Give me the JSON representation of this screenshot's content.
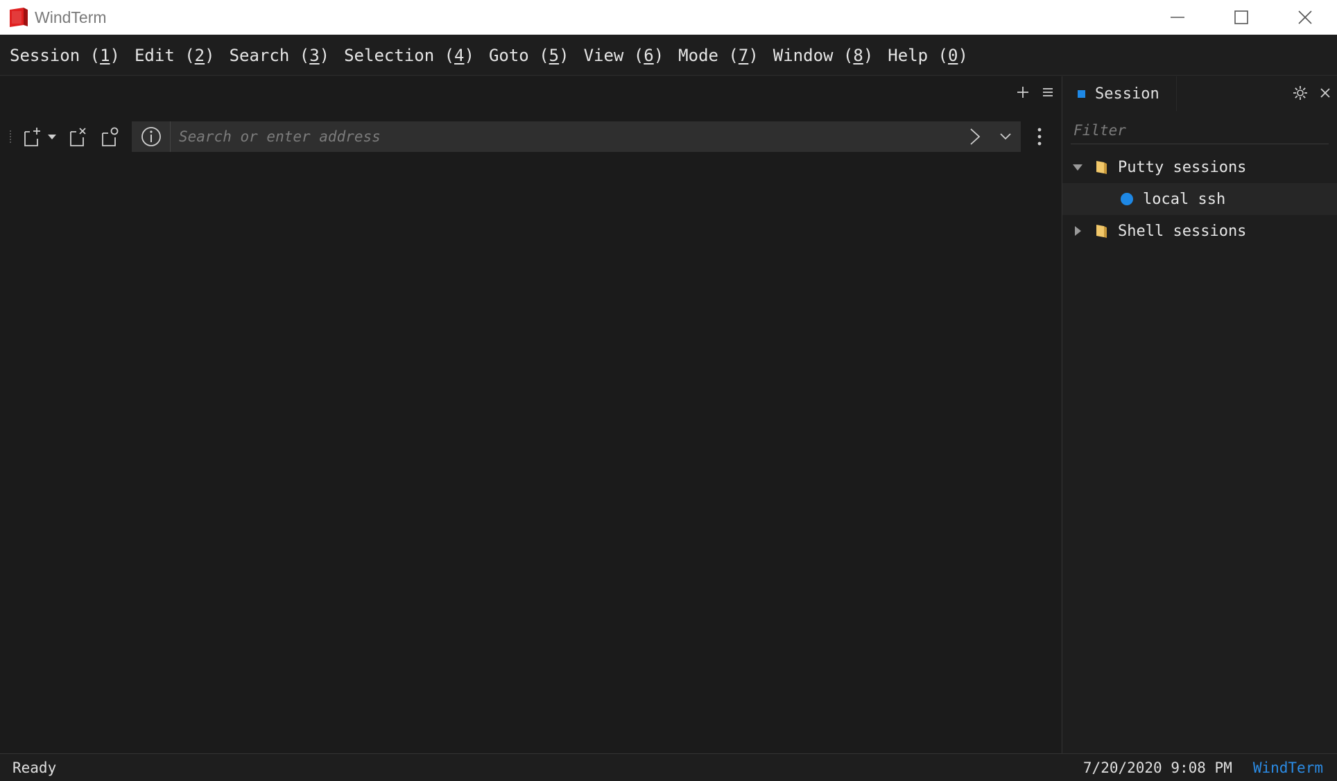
{
  "window": {
    "title": "WindTerm",
    "controls": [
      "minimize",
      "maximize",
      "close"
    ]
  },
  "menu": {
    "items": [
      {
        "label": "Session",
        "key": "1"
      },
      {
        "label": "Edit",
        "key": "2"
      },
      {
        "label": "Search",
        "key": "3"
      },
      {
        "label": "Selection",
        "key": "4"
      },
      {
        "label": "Goto",
        "key": "5"
      },
      {
        "label": "View",
        "key": "6"
      },
      {
        "label": "Mode",
        "key": "7"
      },
      {
        "label": "Window",
        "key": "8"
      },
      {
        "label": "Help",
        "key": "0"
      }
    ]
  },
  "toolbar": {
    "address_placeholder": "Search or enter address",
    "address_value": ""
  },
  "panel": {
    "tab_label": "Session",
    "filter_placeholder": "Filter",
    "tree": [
      {
        "label": "Putty sessions",
        "type": "folder",
        "expanded": true
      },
      {
        "label": "local ssh",
        "type": "session"
      },
      {
        "label": "Shell sessions",
        "type": "folder",
        "expanded": false
      }
    ]
  },
  "status": {
    "text": "Ready",
    "datetime": "7/20/2020 9:08 PM",
    "brand": "WindTerm"
  },
  "colors": {
    "accent": "#1e88e5",
    "logo": "#e02020",
    "folder": "#f2c86a",
    "brand_text": "#2b8ce6"
  }
}
